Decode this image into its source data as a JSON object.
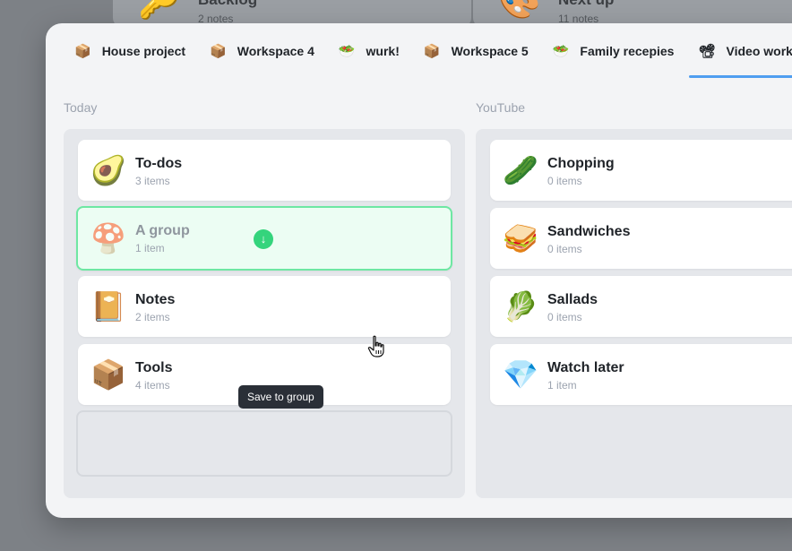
{
  "background": {
    "cards": [
      {
        "title": "Backlog",
        "sub": "2 notes",
        "emoji": "🔑"
      },
      {
        "title": "Next up",
        "sub": "11 notes",
        "emoji": "🎨"
      }
    ]
  },
  "tabs": [
    {
      "emoji": "📦",
      "label": "House project",
      "active": false
    },
    {
      "emoji": "📦",
      "label": "Workspace 4",
      "active": false
    },
    {
      "emoji": "🥗",
      "label": "wurk!",
      "active": false
    },
    {
      "emoji": "📦",
      "label": "Workspace 5",
      "active": false
    },
    {
      "emoji": "🥗",
      "label": "Family recepies",
      "active": false
    },
    {
      "emoji": "📽",
      "label": "Video works",
      "active": true
    }
  ],
  "columns": {
    "today": {
      "title": "Today",
      "cards": [
        {
          "emoji": "🥑",
          "title": "To-dos",
          "sub": "3 items"
        },
        {
          "emoji": "🍄",
          "title": "A group",
          "sub": "1 item"
        },
        {
          "emoji": "📔",
          "title": "Notes",
          "sub": "2 items"
        },
        {
          "emoji": "📦",
          "title": "Tools",
          "sub": "4 items"
        }
      ]
    },
    "youtube": {
      "title": "YouTube",
      "cards": [
        {
          "emoji": "🥒",
          "title": "Chopping",
          "sub": "0 items"
        },
        {
          "emoji": "🥪",
          "title": "Sandwiches",
          "sub": "0 items"
        },
        {
          "emoji": "🥬",
          "title": "Sallads",
          "sub": "0 items"
        },
        {
          "emoji": "💎",
          "title": "Watch later",
          "sub": "1 item"
        }
      ]
    }
  },
  "drop": {
    "icon": "arrow-down-circle-icon",
    "glyph": "↓"
  },
  "tooltip": "Save to group",
  "colors": {
    "accent": "#4f9ef0",
    "drop_border": "#6ee7a3",
    "drop_icon": "#34d47c"
  }
}
